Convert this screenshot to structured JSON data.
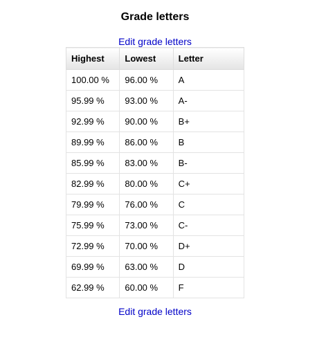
{
  "page": {
    "title": "Grade letters",
    "edit_link_top": "Edit grade letters",
    "edit_link_bottom": "Edit grade letters"
  },
  "table": {
    "headers": [
      "Highest",
      "Lowest",
      "Letter"
    ],
    "rows": [
      [
        "100.00 %",
        "96.00 %",
        "A"
      ],
      [
        "95.99 %",
        "93.00 %",
        "A-"
      ],
      [
        "92.99 %",
        "90.00 %",
        "B+"
      ],
      [
        "89.99 %",
        "86.00 %",
        "B"
      ],
      [
        "85.99 %",
        "83.00 %",
        "B-"
      ],
      [
        "82.99 %",
        "80.00 %",
        "C+"
      ],
      [
        "79.99 %",
        "76.00 %",
        "C"
      ],
      [
        "75.99 %",
        "73.00 %",
        "C-"
      ],
      [
        "72.99 %",
        "70.00 %",
        "D+"
      ],
      [
        "69.99 %",
        "63.00 %",
        "D"
      ],
      [
        "62.99 %",
        "60.00 %",
        "F"
      ]
    ]
  },
  "colors": {
    "link": "#0000c8",
    "header_bg_top": "#ffffff",
    "header_bg_bottom": "#e4e4e4",
    "border": "#e3e3e3"
  }
}
